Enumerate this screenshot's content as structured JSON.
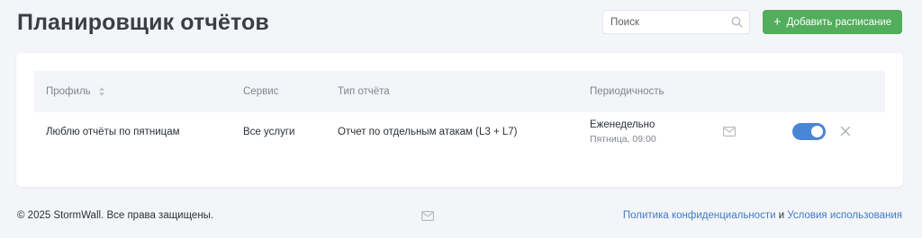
{
  "header": {
    "title": "Планировщик отчётов",
    "search_placeholder": "Поиск",
    "search_value": "",
    "add_button_label": "Добавить расписание",
    "add_button_icon": "plus-icon"
  },
  "table": {
    "columns": {
      "profile": "Профиль",
      "service": "Сервис",
      "report_type": "Тип отчёта",
      "periodicity": "Периодичность"
    },
    "rows": [
      {
        "profile": "Люблю отчёты по пятницам",
        "service": "Все услуги",
        "report_type": "Отчет по отдельным атакам (L3 + L7)",
        "periodicity": "Еженедельно",
        "schedule": "Пятница, 09:00",
        "enabled": true
      }
    ]
  },
  "footer": {
    "copyright": "© 2025 StormWall. Все права защищены.",
    "privacy_link": "Политика конфиденциальности",
    "and_text": "и",
    "terms_link": "Условия использования"
  },
  "colors": {
    "background": "#f4f5f9",
    "accent_green": "#52ad5c",
    "toggle_blue": "#4a86d6",
    "link_blue": "#3d7cc9"
  }
}
